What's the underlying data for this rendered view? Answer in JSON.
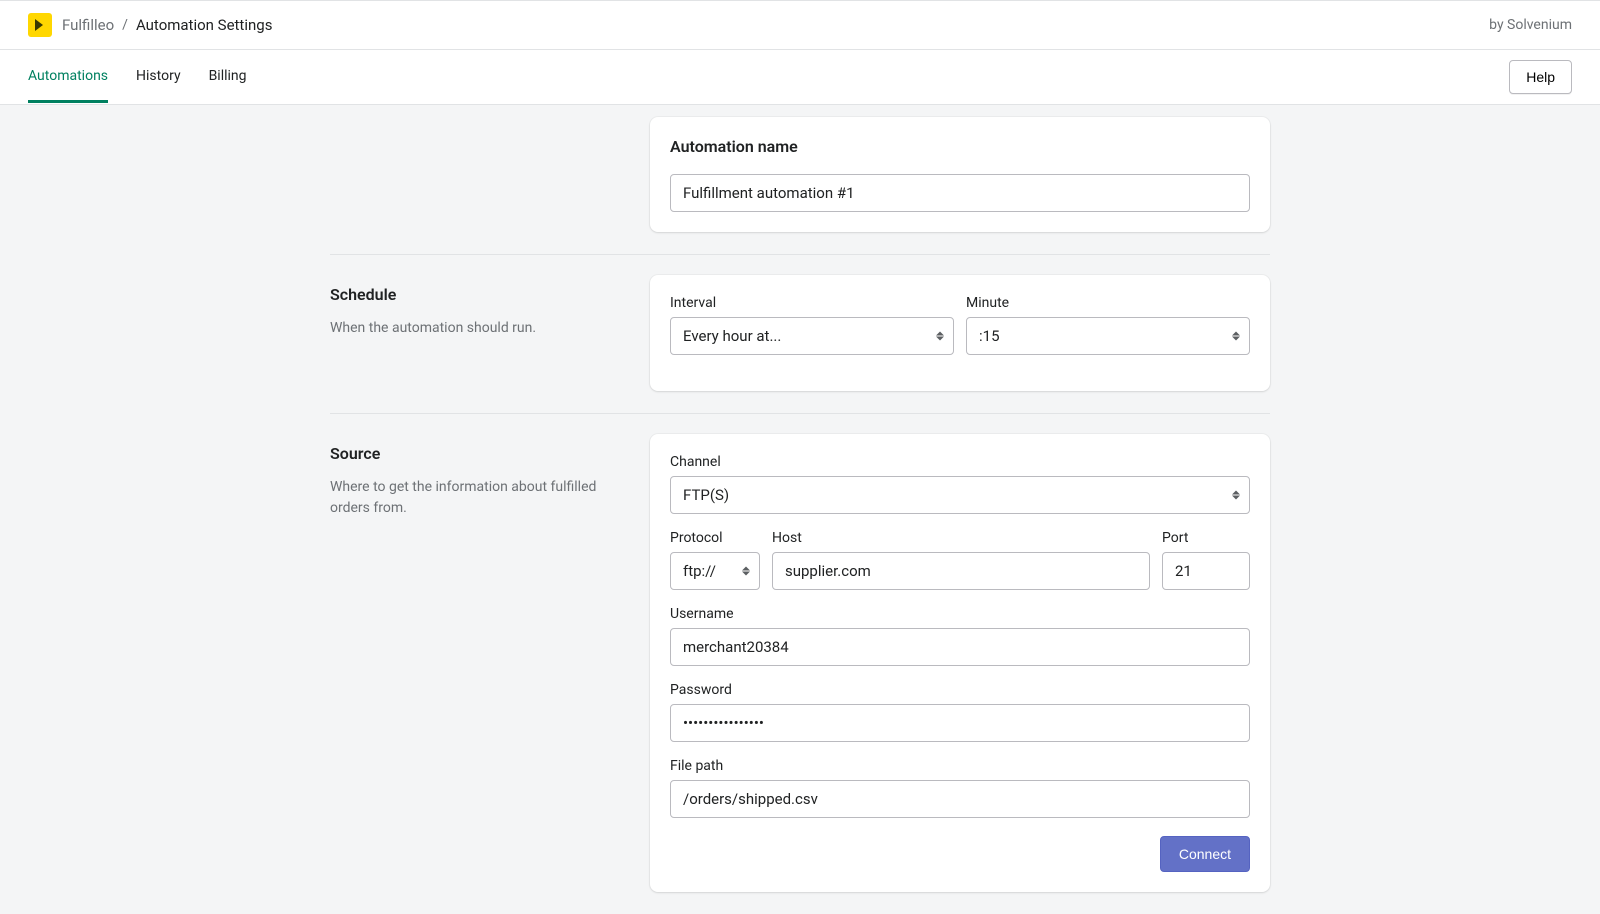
{
  "header": {
    "app_name": "Fulfilleo",
    "page_title": "Automation Settings",
    "byline": "by Solvenium"
  },
  "tabs": {
    "items": [
      "Automations",
      "History",
      "Billing"
    ],
    "active_index": 0,
    "help_label": "Help"
  },
  "name_section": {
    "card_title": "Automation name",
    "value": "Fulfillment automation #1"
  },
  "schedule": {
    "heading": "Schedule",
    "description": "When the automation should run.",
    "interval_label": "Interval",
    "interval_value": "Every hour at...",
    "minute_label": "Minute",
    "minute_value": ":15"
  },
  "source": {
    "heading": "Source",
    "description": "Where to get the information about fulfilled orders from.",
    "channel_label": "Channel",
    "channel_value": "FTP(S)",
    "protocol_label": "Protocol",
    "protocol_value": "ftp://",
    "host_label": "Host",
    "host_value": "supplier.com",
    "port_label": "Port",
    "port_value": "21",
    "username_label": "Username",
    "username_value": "merchant20384",
    "password_label": "Password",
    "password_value": "****************",
    "filepath_label": "File path",
    "filepath_value": "/orders/shipped.csv",
    "connect_label": "Connect"
  }
}
